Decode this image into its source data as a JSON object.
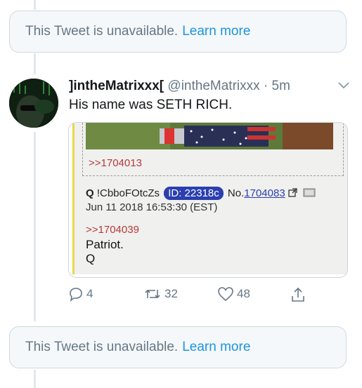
{
  "unavailable_top": {
    "text": "This Tweet is unavailable.",
    "link": "Learn more"
  },
  "tweet": {
    "name": "]intheMatrixxx[",
    "handle": "@intheMatrixxx",
    "dot": "·",
    "time": "5m",
    "text": "His name was SETH RICH.",
    "avatar_caption": "...The Matrix...",
    "qpost": {
      "ref_top": ">>1704013",
      "trip_name": "Q",
      "trip_code": "!CbboFOtcZs",
      "id_badge": "ID: 22318c",
      "post_prefix": "No.",
      "post_number": "1704083",
      "date": "Jun 11 2018 16:53:30 (EST)",
      "ref2": ">>1704039",
      "body_line1": "Patriot.",
      "body_line2": "Q"
    },
    "actions": {
      "replies": "4",
      "retweets": "32",
      "likes": "48"
    }
  },
  "unavailable_bottom": {
    "text": "This Tweet is unavailable.",
    "link": "Learn more"
  },
  "colors": {
    "link": "#1b95e0",
    "muted": "#657786",
    "border": "#cfd9de",
    "id_badge": "#2b3fb0",
    "quote_ref": "#b33b3b"
  }
}
